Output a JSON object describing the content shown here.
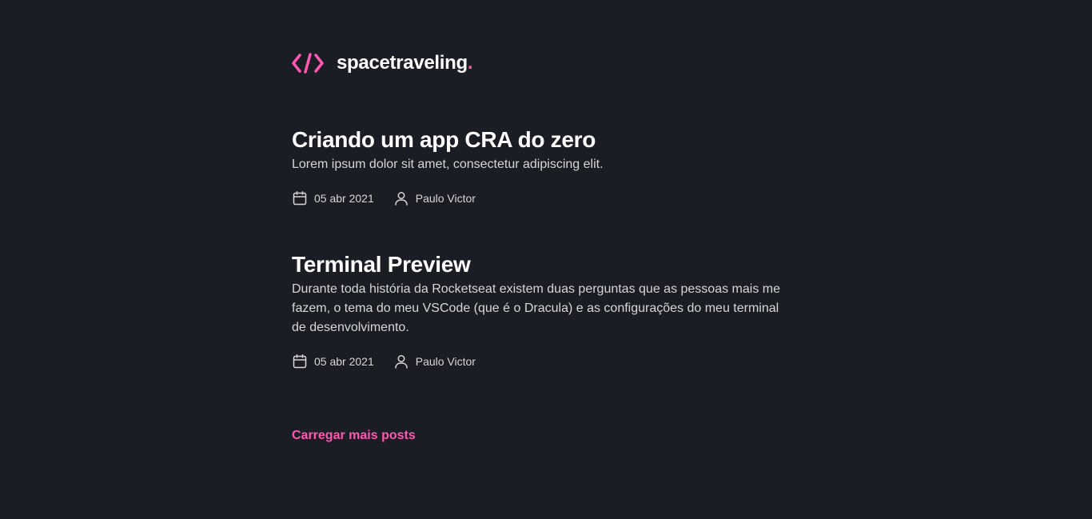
{
  "header": {
    "logo_text": "spacetraveling",
    "logo_dot": ".",
    "logo_icon": "code-brackets-icon"
  },
  "colors": {
    "background": "#1b1d24",
    "accent": "#ff57b2",
    "heading": "#ffffff",
    "body": "#d7d7d7"
  },
  "posts": [
    {
      "title": "Criando um app CRA do zero",
      "subtitle": "Lorem ipsum dolor sit amet, consectetur adipiscing elit.",
      "date": "05 abr 2021",
      "author": "Paulo Victor"
    },
    {
      "title": "Terminal Preview",
      "subtitle": "Durante toda história da Rocketseat existem duas perguntas que as pessoas mais me fazem, o tema do meu VSCode (que é o Dracula) e as configurações do meu terminal de desenvolvimento.",
      "date": "05 abr 2021",
      "author": "Paulo Victor"
    }
  ],
  "load_more_label": "Carregar mais posts"
}
